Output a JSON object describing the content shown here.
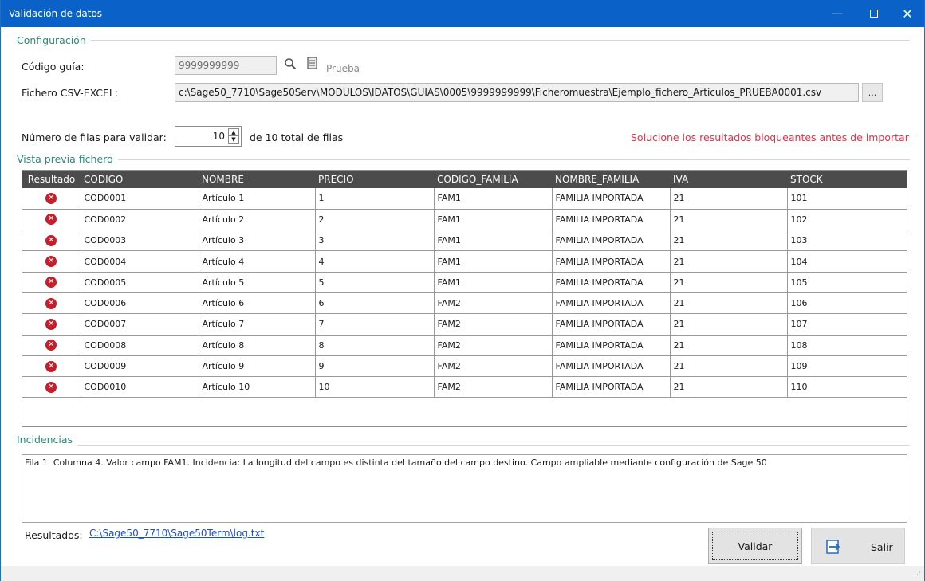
{
  "window": {
    "title": "Validación de datos",
    "min_glyph": "—",
    "close_glyph": "✕"
  },
  "config": {
    "group_title": "Configuración",
    "guide_label": "Código guía:",
    "guide_value": "9999999999",
    "test_label": "Prueba",
    "file_label": "Fichero CSV-EXCEL:",
    "file_value": "c:\\Sage50_7710\\Sage50Serv\\MODULOS\\IDATOS\\GUIAS\\0005\\9999999999\\Ficheromuestra\\Ejemplo_fichero_Articulos_PRUEBA0001.csv",
    "browse_label": "...",
    "rows_label": "Número de filas para validar:",
    "rows_value": "10",
    "rows_total": "de 10 total de filas",
    "warning": "Solucione los resultados bloqueantes antes de importar"
  },
  "preview": {
    "group_title": "Vista previa fichero",
    "columns": [
      "Resultado",
      "CODIGO",
      "NOMBRE",
      "PRECIO",
      "CODIGO_FAMILIA",
      "NOMBRE_FAMILIA",
      "IVA",
      "STOCK"
    ],
    "rows": [
      [
        "error",
        "COD0001",
        "Artículo 1",
        "1",
        "FAM1",
        "FAMILIA IMPORTADA",
        "21",
        "101"
      ],
      [
        "error",
        "COD0002",
        "Artículo 2",
        "2",
        "FAM1",
        "FAMILIA IMPORTADA",
        "21",
        "102"
      ],
      [
        "error",
        "COD0003",
        "Artículo 3",
        "3",
        "FAM1",
        "FAMILIA IMPORTADA",
        "21",
        "103"
      ],
      [
        "error",
        "COD0004",
        "Artículo 4",
        "4",
        "FAM1",
        "FAMILIA IMPORTADA",
        "21",
        "104"
      ],
      [
        "error",
        "COD0005",
        "Artículo 5",
        "5",
        "FAM1",
        "FAMILIA IMPORTADA",
        "21",
        "105"
      ],
      [
        "error",
        "COD0006",
        "Artículo 6",
        "6",
        "FAM2",
        "FAMILIA IMPORTADA",
        "21",
        "106"
      ],
      [
        "error",
        "COD0007",
        "Artículo 7",
        "7",
        "FAM2",
        "FAMILIA IMPORTADA",
        "21",
        "107"
      ],
      [
        "error",
        "COD0008",
        "Artículo 8",
        "8",
        "FAM2",
        "FAMILIA IMPORTADA",
        "21",
        "108"
      ],
      [
        "error",
        "COD0009",
        "Artículo 9",
        "9",
        "FAM2",
        "FAMILIA IMPORTADA",
        "21",
        "109"
      ],
      [
        "error",
        "COD0010",
        "Artículo 10",
        "10",
        "FAM2",
        "FAMILIA IMPORTADA",
        "21",
        "110"
      ]
    ]
  },
  "incidencias": {
    "group_title": "Incidencias",
    "text": "Fila 1. Columna 4. Valor campo FAM1. Incidencia: La longitud del campo es distinta del tamaño del campo destino. Campo ampliable mediante configuración de Sage 50"
  },
  "footer": {
    "results_label": "Resultados:",
    "results_link": "C:\\Sage50_7710\\Sage50Term\\log.txt",
    "validate_label": "Validar",
    "exit_label": "Salir"
  },
  "colors": {
    "titlebar": "#0a62c9",
    "group_title": "#2b8a74",
    "warning": "#e0344c",
    "error_icon": "#c81d2a",
    "grid_header": "#4c4c4c",
    "link": "#1a4ed8"
  },
  "icons": {
    "search": "search-icon",
    "document": "document-icon",
    "error": "error-icon",
    "exit": "exit-arrow-icon"
  }
}
